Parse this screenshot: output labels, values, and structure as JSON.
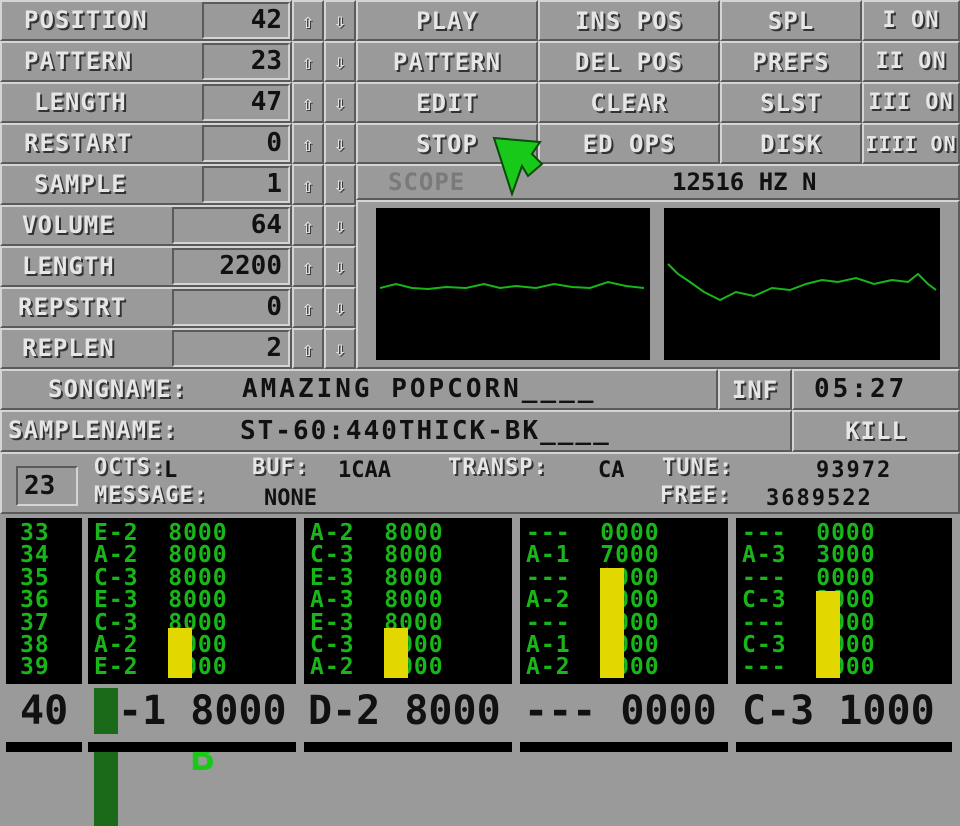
{
  "song_controls": [
    {
      "label": "POSITION",
      "value": "42"
    },
    {
      "label": "PATTERN",
      "value": "23"
    },
    {
      "label": "LENGTH",
      "value": "47"
    },
    {
      "label": "RESTART",
      "value": "0"
    }
  ],
  "sample_controls": [
    {
      "label": "SAMPLE",
      "value": "1"
    },
    {
      "label": "VOLUME",
      "value": "64"
    },
    {
      "label": "LENGTH",
      "value": "2200"
    },
    {
      "label": "REPSTRT",
      "value": "0"
    },
    {
      "label": "REPLEN",
      "value": "2"
    }
  ],
  "arrows": {
    "up": "⇧",
    "down": "⇩"
  },
  "buttons": {
    "col1": [
      "PLAY",
      "PATTERN",
      "EDIT",
      "STOP"
    ],
    "col2": [
      "INS POS",
      "DEL POS",
      "CLEAR",
      "ED OPS"
    ],
    "col3": [
      "SPL",
      "PREFS",
      "SLST",
      "DISK"
    ],
    "channels": [
      "I ON",
      "II ON",
      "III ON",
      "IIII ON"
    ]
  },
  "scope": {
    "label": "SCOPE",
    "freq": "12516 HZ N"
  },
  "song": {
    "label": "SONGNAME:",
    "name": "AMAZING POPCORN____",
    "inf": "INF",
    "time": "05:27"
  },
  "sample": {
    "label": "SAMPLENAME:",
    "name": "ST-60:440THICK-BK____",
    "kill": "KILL"
  },
  "info": {
    "pattern_num": "23",
    "octs_label": "OCTS:",
    "octs": "L",
    "buf_label": "BUF:",
    "buf": "1CAA",
    "transp_label": "TRANSP:",
    "transp": "CA",
    "tune_label": "TUNE:",
    "tune": "93972",
    "message_label": "MESSAGE:",
    "message": "NONE",
    "free_label": "FREE:",
    "free": "3689522"
  },
  "pattern": {
    "row_numbers": [
      "33",
      "34",
      "35",
      "36",
      "37",
      "38",
      "39"
    ],
    "channels": [
      {
        "rows": [
          "E-2  8000",
          "A-2  8000",
          "C-3  8000",
          "E-3  8000",
          "C-3  8000",
          "A-2  8000",
          "E-2  8000"
        ],
        "vu_level": 0.33
      },
      {
        "rows": [
          "A-2  8000",
          "C-3  8000",
          "E-3  8000",
          "A-3  8000",
          "E-3  8000",
          "C-3  8000",
          "A-2  8000"
        ],
        "vu_level": 0.33
      },
      {
        "rows": [
          "---  0000",
          "A-1  7000",
          "---  0000",
          "A-2  7000",
          "---  0000",
          "A-1  7000",
          "A-2  7000"
        ],
        "vu_level": 0.73
      },
      {
        "rows": [
          "---  0000",
          "A-3  3000",
          "---  0000",
          "C-3  2000",
          "---  0000",
          "C-3  1000",
          "---  0000"
        ],
        "vu_level": 0.58
      }
    ],
    "current_row": {
      "number": "40",
      "cursor_char": "B",
      "channels": [
        "-1 8000",
        "D-2 8000",
        "--- 0000",
        "C-3 1000"
      ]
    }
  },
  "colors": {
    "panel": "#9a9a9a",
    "pattern_text": "#19b619",
    "vu": "#e2d800",
    "pointer": "#19c919"
  }
}
